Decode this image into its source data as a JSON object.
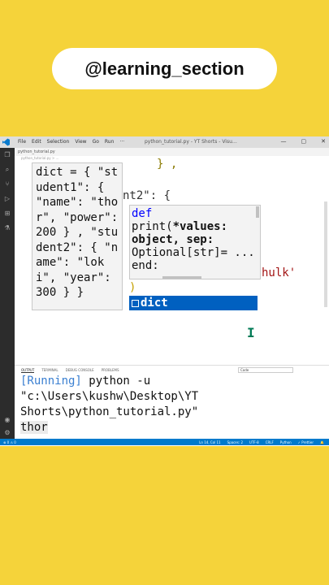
{
  "handle": "@learning_section",
  "window": {
    "menu": [
      "File",
      "Edit",
      "Selection",
      "View",
      "Go",
      "Run",
      "···"
    ],
    "title": "python_tutorial.py - YT Shorts - Visu…",
    "controls": [
      "—",
      "▢",
      "✕"
    ]
  },
  "tab": {
    "label": "python_tutorial.py"
  },
  "breadcrumb": "python_tutorial.py > ...",
  "editor": {
    "lines": [
      {
        "text": "} ,",
        "color": "#8a7a00"
      },
      {
        "text": "nt2\": {",
        "color": "#333333"
      },
      {
        "text": "hulk'",
        "color": "#a31515"
      },
      {
        "text": ")",
        "color": "#c4a000"
      }
    ]
  },
  "hover": {
    "lines": [
      "dict = { \"st",
      "udent1\": {",
      "\"name\": \"tho",
      "r\", \"power\":",
      "200 } , \"stu",
      "dent2\": { \"n",
      "ame\": \"lok",
      "i\", \"year\":",
      "300 } }"
    ]
  },
  "signature": {
    "kw": "def",
    "line1": "print(",
    "line1_param": "*values:",
    "line2": "object, sep:",
    "line3": "Optional[str]= ... ,",
    "line4": "end:"
  },
  "suggest": {
    "label": "dict"
  },
  "panel": {
    "tabs": [
      "OUTPUT",
      "TERMINAL",
      "DEBUG CONSOLE",
      "PROBLEMS"
    ],
    "selector": "Code",
    "running": "[Running]",
    "cmd1": " python -u",
    "cmd2": "\"c:\\Users\\kushw\\Desktop\\YT",
    "cmd3": "Shorts\\python_tutorial.py\"",
    "result": "thor"
  },
  "status": {
    "left": "⊗ 0 ⚠ 0",
    "right": [
      "Ln 14, Col 11",
      "Spaces: 2",
      "UTF-8",
      "CRLF",
      "Python",
      "✓ Prettier",
      "🔔"
    ]
  }
}
